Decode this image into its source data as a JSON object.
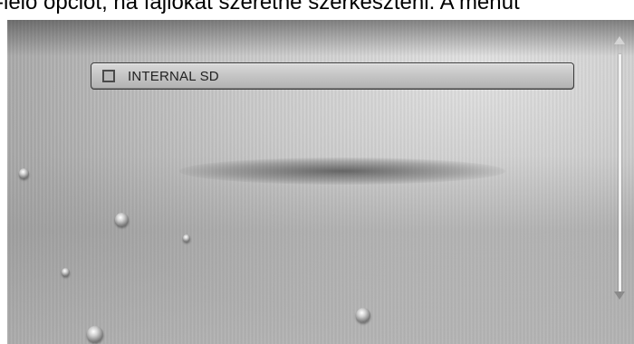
{
  "caption": {
    "text": "-lelő opciót, ha fájlokat szeretne szerkeszteni. A menüt"
  },
  "drive_list": {
    "items": [
      {
        "label": "INTERNAL SD",
        "checked": false
      }
    ]
  },
  "icons": {
    "checkbox": "checkbox-icon",
    "scroll_up": "triangle-up-icon",
    "scroll_down": "triangle-down-icon"
  },
  "colors": {
    "background": "#b4b4b4",
    "item_border": "#3a3a3a",
    "text": "#222222"
  }
}
